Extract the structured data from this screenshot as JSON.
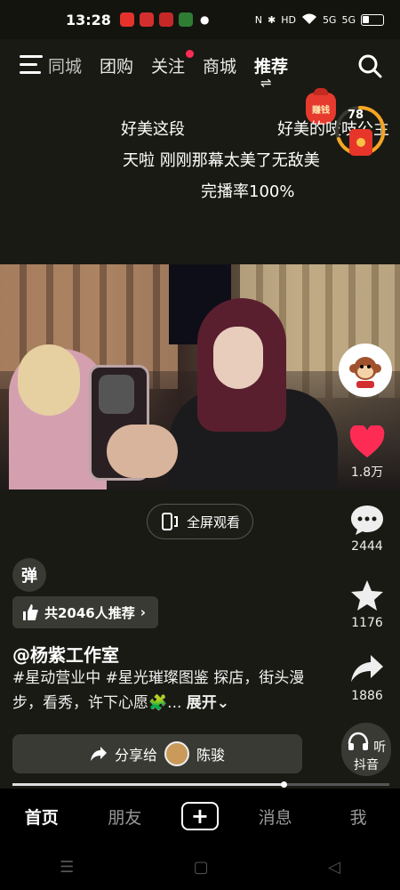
{
  "status_bar": {
    "time": "13:28",
    "network": "5G",
    "hd": "HD"
  },
  "nav": {
    "tabs": [
      "同城",
      "团购",
      "关注",
      "商城",
      "推荐"
    ],
    "active_tab": "推荐",
    "earn_label": "赚钱"
  },
  "danmaku": [
    "好美这段",
    "好美的吱吱公主",
    "天啦 刚刚那幕太美了无敌美",
    "完播率100%"
  ],
  "timer": {
    "value": "78"
  },
  "video": {
    "fullscreen_label": "全屏观看"
  },
  "actions": {
    "likes": "1.8万",
    "comments": "2444",
    "favorites": "1176",
    "shares": "1886",
    "listen_label": "听抖音"
  },
  "post": {
    "danmu_toggle": "弹",
    "recommend_label": "共2046人推荐",
    "author": "@杨紫工作室",
    "caption": "#星动营业中 #星光璀璨图鉴 探店，街头漫步，看秀，许下心愿🧩...",
    "expand_label": "展开",
    "share_label": "分享给",
    "share_target": "陈骏"
  },
  "progress": {
    "value": 0.72
  },
  "bottom_nav": {
    "home": "首页",
    "friends": "朋友",
    "add": "+",
    "messages": "消息",
    "me": "我"
  },
  "colors": {
    "accent_red": "#fe2c55",
    "background": "#1a1a14"
  }
}
